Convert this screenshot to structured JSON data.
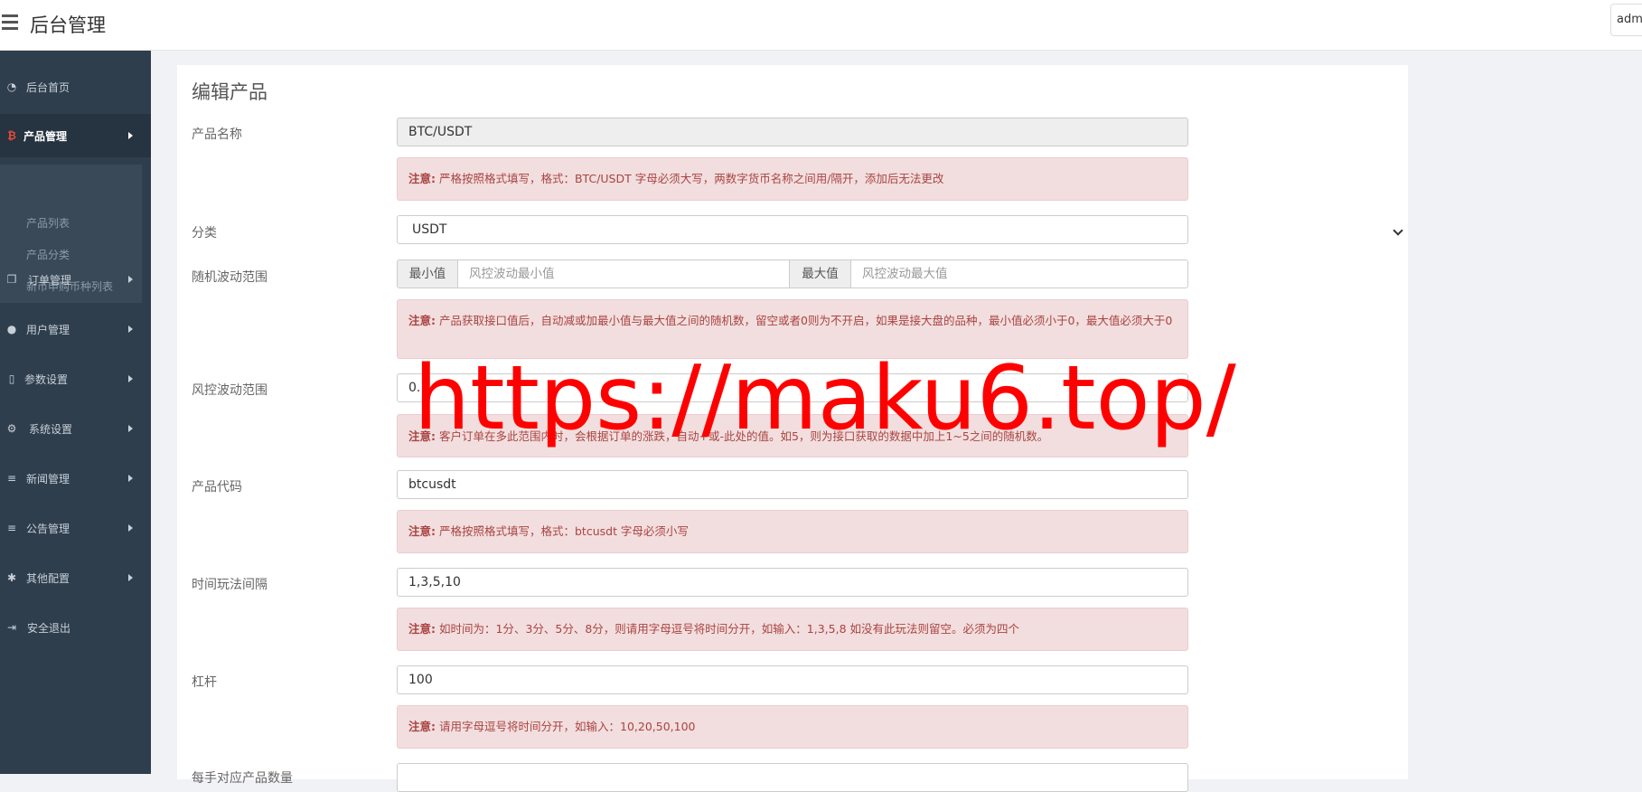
{
  "header": {
    "title": "后台管理",
    "user": "adm"
  },
  "sidebar": {
    "items": [
      {
        "label": "后台首页",
        "icon": "dashboard-icon"
      },
      {
        "label": "产品管理",
        "icon": "bitcoin-icon"
      },
      {
        "label": "订单管理",
        "icon": "copy-icon"
      },
      {
        "label": "用户管理",
        "icon": "user-icon"
      },
      {
        "label": "参数设置",
        "icon": "file-icon"
      },
      {
        "label": "系统设置",
        "icon": "cogs-icon"
      },
      {
        "label": "新闻管理",
        "icon": "list-icon"
      },
      {
        "label": "公告管理",
        "icon": "list-icon"
      },
      {
        "label": "其他配置",
        "icon": "gear-icon"
      },
      {
        "label": "安全退出",
        "icon": "sign-out-icon"
      }
    ],
    "submenu": [
      "产品列表",
      "产品分类",
      "新币申购币种列表"
    ]
  },
  "form": {
    "title": "编辑产品",
    "note_label": "注意:",
    "name_label": "产品名称",
    "name_value": "BTC/USDT",
    "name_note": "严格按照格式填写，格式：BTC/USDT 字母必须大写，两数字货币名称之间用/隔开，添加后无法更改",
    "category_label": "分类",
    "category_value": "USDT",
    "random_label": "随机波动范围",
    "min_addon": "最小值",
    "min_placeholder": "风控波动最小值",
    "max_addon": "最大值",
    "max_placeholder": "风控波动最大值",
    "random_note": "产品获取接口值后，自动减或加最小值与最大值之间的随机数，留空或者0则为不开启，如果是接大盘的品种，最小值必须小于0，最大值必须大于0",
    "risk_label": "风控波动范围",
    "risk_value": "0.1",
    "risk_note": "客户订单在多此范围内时，会根据订单的涨跌，自动+或-此处的值。如5，则为接口获取的数据中加上1~5之间的随机数。",
    "code_label": "产品代码",
    "code_value": "btcusdt",
    "code_note": "严格按照格式填写，格式：btcusdt 字母必须小写",
    "time_label": "时间玩法间隔",
    "time_value": "1,3,5,10",
    "time_note": "如时间为：1分、3分、5分、8分，则请用字母逗号将时间分开，如输入：1,3,5,8 如没有此玩法则留空。必须为四个",
    "lever_label": "杠杆",
    "lever_value": "100",
    "lever_note": "请用字母逗号将时间分开，如输入：10,20,50,100",
    "next_label": "每手对应产品数量"
  },
  "watermark": "https://maku6.top/"
}
